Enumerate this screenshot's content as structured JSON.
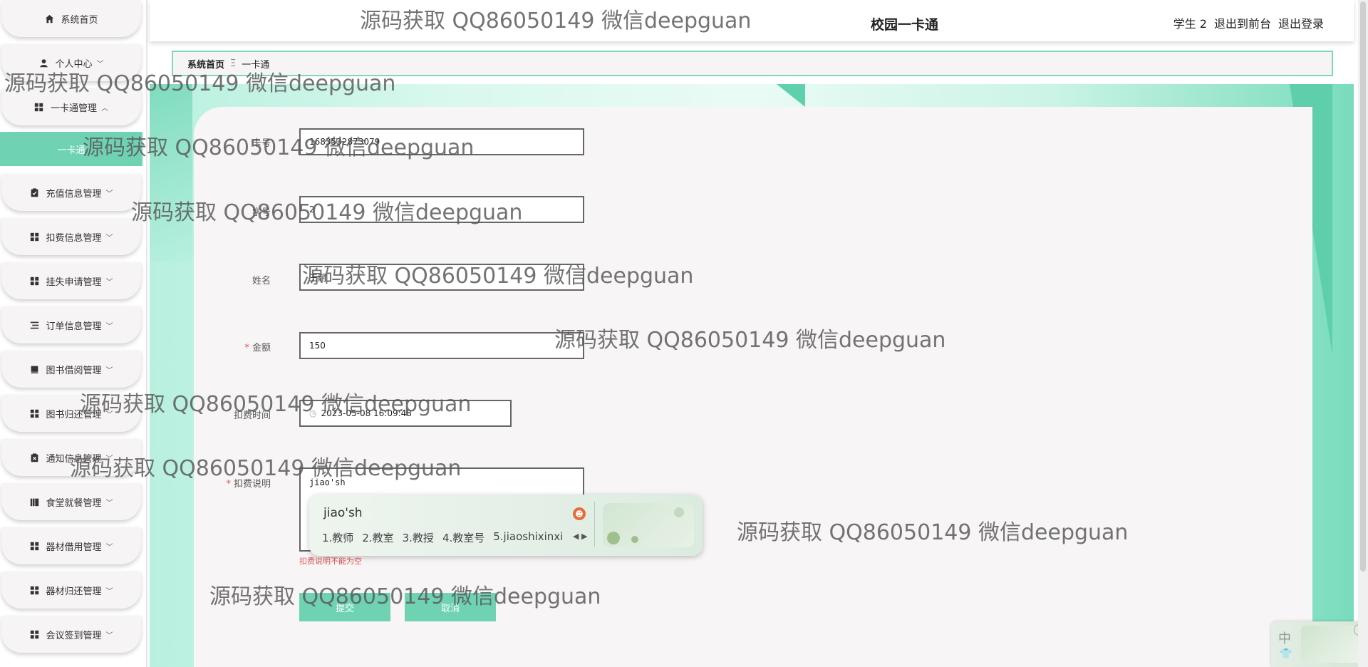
{
  "header": {
    "site_title": "校园一卡通",
    "user_label": "学生 2",
    "front_link": "退出到前台",
    "logout_link": "退出登录"
  },
  "breadcrumb": {
    "home": "系统首页",
    "separator": "Ξ",
    "current": "一卡通"
  },
  "sidebar": {
    "items": [
      {
        "label": "系统首页",
        "icon": "home-icon"
      },
      {
        "label": "个人中心",
        "icon": "user-icon"
      },
      {
        "label": "一卡通管理",
        "icon": "grid-icon"
      },
      {
        "label": "一卡通",
        "icon": ""
      },
      {
        "label": "充值信息管理",
        "icon": "clipboard-icon"
      },
      {
        "label": "扣费信息管理",
        "icon": "grid-icon"
      },
      {
        "label": "挂失申请管理",
        "icon": "grid-icon"
      },
      {
        "label": "订单信息管理",
        "icon": "list-icon"
      },
      {
        "label": "图书借阅管理",
        "icon": "book-icon"
      },
      {
        "label": "图书归还管理",
        "icon": "grid-icon"
      },
      {
        "label": "通知信息管理",
        "icon": "clipboard-x-icon"
      },
      {
        "label": "食堂就餐管理",
        "icon": "book-stack-icon"
      },
      {
        "label": "器材借用管理",
        "icon": "grid-icon"
      },
      {
        "label": "器材归还管理",
        "icon": "grid-icon"
      },
      {
        "label": "会议签到管理",
        "icon": "grid-icon"
      }
    ]
  },
  "form": {
    "card_no": {
      "label": "卡号",
      "value": "1683532873079"
    },
    "student_no": {
      "label": "学号",
      "value": "2"
    },
    "name": {
      "label": "姓名",
      "value": "王丽"
    },
    "amount": {
      "label": "金额",
      "value": "150"
    },
    "time": {
      "label": "扣费时间",
      "value": "2023-05-08 16:09:48"
    },
    "desc": {
      "label": "扣费说明",
      "value": "jiao'sh",
      "error": "扣费说明不能为空"
    },
    "submit": "提交",
    "cancel": "取消"
  },
  "ime": {
    "composition": "jiao'sh",
    "candidates": [
      "1.教师",
      "2.教室",
      "3.教授",
      "4.教室号",
      "5.jiaoshixinxi"
    ],
    "tray_mode": "中"
  },
  "watermark": "源码获取 QQ86050149 微信deepguan",
  "colors": {
    "accent": "#6fd3b3",
    "error": "#e2524f"
  }
}
